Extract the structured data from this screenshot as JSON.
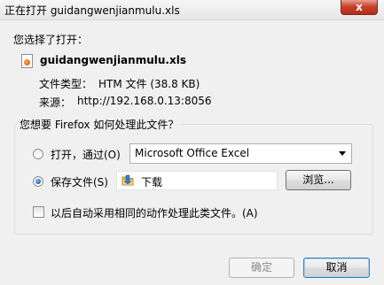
{
  "window": {
    "title": "正在打开 guidangwenjianmulu.xls",
    "close_label": "x"
  },
  "file": {
    "intro": "您选择了打开：",
    "name": "guidangwenjianmulu.xls",
    "type_label": "文件类型：",
    "type_value": "HTM 文件 (38.8 KB)",
    "source_label": "来源：",
    "source_value": "http://192.168.0.13:8056"
  },
  "options": {
    "group_label": "您想要 Firefox 如何处理此文件？",
    "open_with_label": "打开，通过(O)",
    "open_with_app": "Microsoft Office Excel",
    "save_file_label": "保存文件(S)",
    "save_folder": "下载",
    "browse_label": "浏览...",
    "remember_label": "以后自动采用相同的动作处理此类文件。(A)",
    "open_with_selected": false,
    "save_file_selected": true,
    "remember_checked": false
  },
  "footer": {
    "ok_label": "确定",
    "cancel_label": "取消"
  },
  "colors": {
    "close_button": "#c8442c",
    "folder": "#e8b84a",
    "radio_dot": "#1f62c2"
  },
  "icons": {
    "file": "firefox-document-icon",
    "folder": "folder-icon",
    "dropdown": "chevron-down-icon"
  }
}
